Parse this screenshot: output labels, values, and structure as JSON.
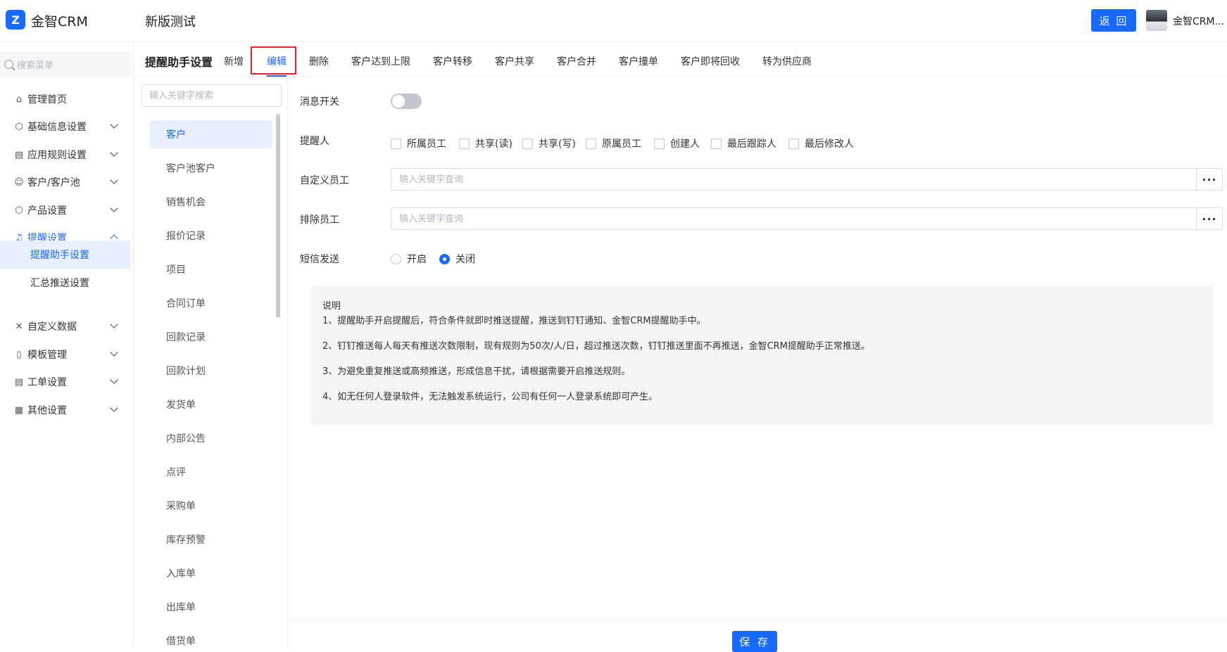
{
  "app": {
    "brand": "金智CRM",
    "page_heading": "新版测试",
    "back_label": "返 回",
    "user_name": "金智CRM..."
  },
  "colors": {
    "primary": "#1769ff",
    "highlight": "#e8202a"
  },
  "sidebar": {
    "search_placeholder": "搜索菜单",
    "items": [
      {
        "label": "管理首页",
        "icon": "home-icon"
      },
      {
        "label": "基础信息设置",
        "icon": "cube-icon"
      },
      {
        "label": "应用规则设置",
        "icon": "doc-icon"
      },
      {
        "label": "客户/客户池",
        "icon": "users-icon"
      },
      {
        "label": "产品设置",
        "icon": "box-icon"
      },
      {
        "label": "提醒设置",
        "icon": "bell-icon"
      },
      {
        "label": "自定义数据",
        "icon": "puzzle-icon"
      },
      {
        "label": "模板管理",
        "icon": "template-icon"
      },
      {
        "label": "工单设置",
        "icon": "ticket-icon"
      },
      {
        "label": "其他设置",
        "icon": "grid-icon"
      }
    ],
    "sub_items": [
      "提醒助手设置",
      "汇总推送设置"
    ]
  },
  "tabs": {
    "title": "提醒助手设置",
    "items": [
      "新增",
      "编辑",
      "删除",
      "客户达到上限",
      "客户转移",
      "客户共享",
      "客户合并",
      "客户撞单",
      "客户即将回收",
      "转为供应商"
    ]
  },
  "objects": {
    "search_placeholder": "输入关键字搜索",
    "items": [
      "客户",
      "客户池客户",
      "销售机会",
      "报价记录",
      "项目",
      "合同订单",
      "回款记录",
      "回款计划",
      "发货单",
      "内部公告",
      "点评",
      "采购单",
      "库存预警",
      "入库单",
      "出库单",
      "借货单"
    ]
  },
  "form": {
    "switch_label": "消息开关",
    "remind_label": "提醒人",
    "remind_options": [
      "所属员工",
      "共享(读)",
      "共享(写)",
      "原属员工",
      "创建人",
      "最后跟踪人",
      "最后修改人"
    ],
    "custom_label": "自定义员工",
    "custom_placeholder": "输入关键字查询",
    "exclude_label": "排除员工",
    "exclude_placeholder": "输入关键字查询",
    "sms_label": "短信发送",
    "sms_on": "开启",
    "sms_off": "关闭",
    "more": "···"
  },
  "notes": {
    "title": "说明",
    "lines": [
      "1、提醒助手开启提醒后，符合条件就即时推送提醒，推送到钉钉通知、金智CRM提醒助手中。",
      "2、钉钉推送每人每天有推送次数限制，现有规则为50次/人/日，超过推送次数，钉钉推送里面不再推送，金智CRM提醒助手正常推送。",
      "3、为避免重复推送或高频推送，形成信息干扰，请根据需要开启推送规则。",
      "4、如无任何人登录软件，无法触发系统运行，公司有任何一人登录系统即可产生。"
    ]
  },
  "footer": {
    "save_label": "保 存"
  }
}
